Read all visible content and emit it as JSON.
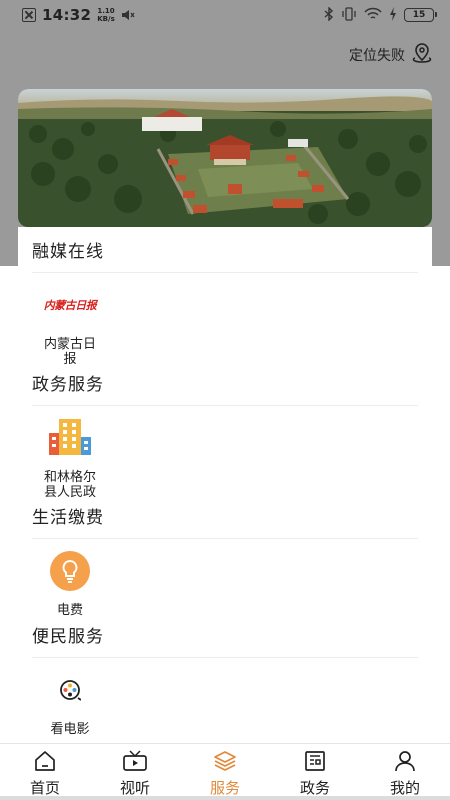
{
  "status_bar": {
    "time": "14:32",
    "speed_value": "1.10",
    "speed_unit": "KB/s",
    "battery": "15"
  },
  "location": {
    "text": "定位失败",
    "icon": "location-pin-icon"
  },
  "banner": {
    "description_icon": "temple-aerial-photo"
  },
  "sections": [
    {
      "title": "融媒在线",
      "items": [
        {
          "label": "内蒙古日报",
          "icon": "inner-mongolia-daily-logo",
          "logo_text": "内蒙古日报"
        }
      ]
    },
    {
      "title": "政务服务",
      "items": [
        {
          "label": "和林格尔县人民政",
          "icon": "government-building-icon"
        }
      ]
    },
    {
      "title": "生活缴费",
      "items": [
        {
          "label": "电费",
          "icon": "lightbulb-icon"
        }
      ]
    },
    {
      "title": "便民服务",
      "items": [
        {
          "label": "看电影",
          "icon": "film-reel-icon"
        }
      ]
    }
  ],
  "bottom_nav": [
    {
      "label": "首页",
      "icon": "home-icon",
      "active": false
    },
    {
      "label": "视听",
      "icon": "video-icon",
      "active": false
    },
    {
      "label": "服务",
      "icon": "layers-icon",
      "active": true
    },
    {
      "label": "政务",
      "icon": "newspaper-icon",
      "active": false
    },
    {
      "label": "我的",
      "icon": "user-icon",
      "active": false
    }
  ],
  "colors": {
    "accent": "#e08a3a",
    "header_bg": "#9a9a9a",
    "logo_red": "#d8231f"
  }
}
